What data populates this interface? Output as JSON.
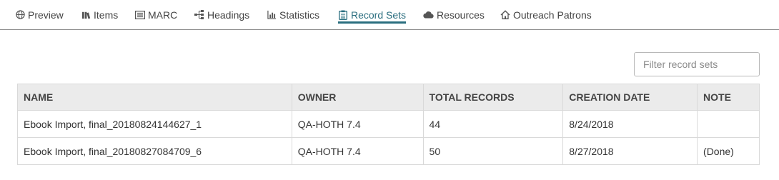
{
  "tabs": [
    {
      "label": "Preview",
      "icon": "globe-icon",
      "active": false
    },
    {
      "label": "Items",
      "icon": "books-icon",
      "active": false
    },
    {
      "label": "MARC",
      "icon": "list-icon",
      "active": false
    },
    {
      "label": "Headings",
      "icon": "sitemap-icon",
      "active": false
    },
    {
      "label": "Statistics",
      "icon": "bar-chart-icon",
      "active": false
    },
    {
      "label": "Record Sets",
      "icon": "clipboard-icon",
      "active": true
    },
    {
      "label": "Resources",
      "icon": "cloud-icon",
      "active": false
    },
    {
      "label": "Outreach Patrons",
      "icon": "home-icon",
      "active": false
    }
  ],
  "colors": {
    "accent": "#2a6e7f",
    "header_bg": "#ebebeb",
    "border": "#d9d9d9"
  },
  "filter": {
    "placeholder": "Filter record sets",
    "value": ""
  },
  "table": {
    "columns": [
      "NAME",
      "OWNER",
      "TOTAL RECORDS",
      "CREATION DATE",
      "NOTE"
    ],
    "rows": [
      [
        "Ebook Import, final_20180824144627_1",
        "QA-HOTH 7.4",
        "44",
        "8/24/2018",
        ""
      ],
      [
        "Ebook Import, final_20180827084709_6",
        "QA-HOTH 7.4",
        "50",
        "8/27/2018",
        "(Done)"
      ]
    ]
  }
}
